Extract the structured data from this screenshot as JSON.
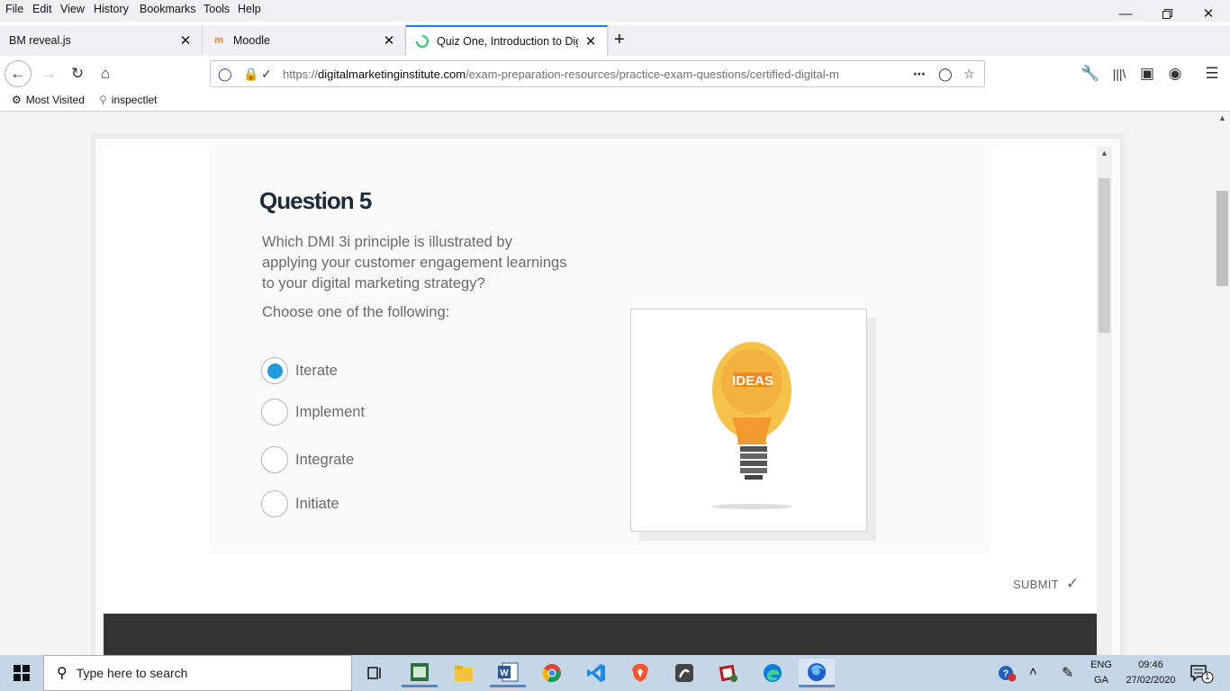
{
  "menubar": {
    "items": [
      "File",
      "Edit",
      "View",
      "History",
      "Bookmarks",
      "Tools",
      "Help"
    ]
  },
  "tabs": [
    {
      "title": "BM reveal.js",
      "active": false
    },
    {
      "title": "Moodle",
      "active": false
    },
    {
      "title": "Quiz One, Introduction to Digit",
      "active": true
    }
  ],
  "navbar": {
    "url_prefix": "https://",
    "url_domain": "digitalmarketinginstitute.com",
    "url_path": "/exam-preparation-resources/practice-exam-questions/certified-digital-m"
  },
  "bookmarks": [
    {
      "label": "Most Visited",
      "icon": "gear-icon"
    },
    {
      "label": "inspectlet",
      "icon": "magnifier-icon"
    }
  ],
  "quiz": {
    "title": "Question 5",
    "question": "Which DMI 3i principle is illustrated by applying your customer engagement learnings to your digital marketing strategy?",
    "instruction": "Choose one of the following:",
    "options": [
      {
        "label": "Iterate",
        "selected": true
      },
      {
        "label": "Implement",
        "selected": false
      },
      {
        "label": "Integrate",
        "selected": false
      },
      {
        "label": "Initiate",
        "selected": false
      }
    ],
    "image_label": "IDEAS",
    "submit_label": "SUBMIT"
  },
  "taskbar": {
    "search_placeholder": "Type here to search",
    "lang_top": "ENG",
    "lang_bottom": "GA",
    "time": "09:46",
    "date": "27/02/2020",
    "notifications": "1"
  },
  "colors": {
    "accent": "#0a84ff",
    "radio_selected": "#1f9bde",
    "title": "#1d2b3a",
    "text": "#6a6a6a",
    "taskbar": "#c5d6e8"
  }
}
